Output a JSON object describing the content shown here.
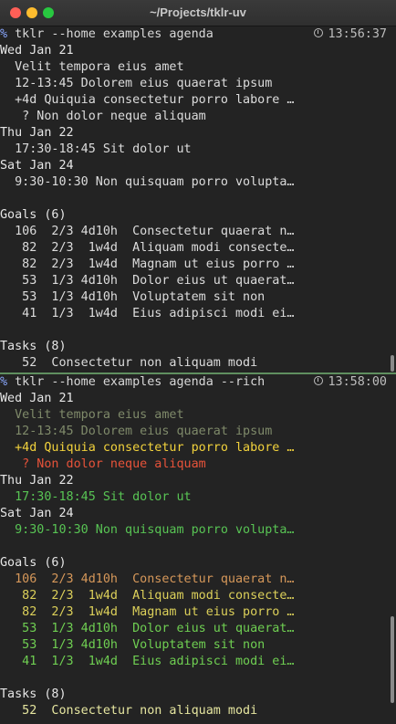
{
  "window": {
    "title": "~/Projects/tklr-uv"
  },
  "top": {
    "prompt_symbol": "%",
    "command": " tklr --home examples agenda",
    "clock": "13:56:37",
    "lines": [
      "Wed Jan 21",
      "  Velit tempora eius amet",
      "  12-13:45 Dolorem eius quaerat ipsum",
      "  +4d Quiquia consectetur porro labore …",
      "   ? Non dolor neque aliquam",
      "Thu Jan 22",
      "  17:30-18:45 Sit dolor ut",
      "Sat Jan 24",
      "  9:30-10:30 Non quisquam porro volupta…",
      "",
      "Goals (6)",
      "  106  2/3 4d10h  Consectetur quaerat n…",
      "   82  2/3  1w4d  Aliquam modi consecte…",
      "   82  2/3  1w4d  Magnam ut eius porro …",
      "   53  1/3 4d10h  Dolor eius ut quaerat…",
      "   53  1/3 4d10h  Voluptatem sit non",
      "   41  1/3  1w4d  Eius adipisci modi ei…",
      "",
      "Tasks (8)",
      "   52  Consectetur non aliquam modi"
    ]
  },
  "bottom": {
    "prompt_symbol": "%",
    "command": " tklr --home examples agenda --rich",
    "clock": "13:58:00",
    "lines": [
      "Wed Jan 21",
      "  Velit tempora eius amet",
      "  12-13:45 Dolorem eius quaerat ipsum",
      "  +4d Quiquia consectetur porro labore …",
      "   ? Non dolor neque aliquam",
      "Thu Jan 22",
      "  17:30-18:45 Sit dolor ut",
      "Sat Jan 24",
      "  9:30-10:30 Non quisquam porro volupta…",
      "",
      "Goals (6)",
      "  106  2/3 4d10h  Consectetur quaerat n…",
      "   82  2/3  1w4d  Aliquam modi consecte…",
      "   82  2/3  1w4d  Magnam ut eius porro …",
      "   53  1/3 4d10h  Dolor eius ut quaerat…",
      "   53  1/3 4d10h  Voluptatem sit non",
      "   41  1/3  1w4d  Eius adipisci modi ei…",
      "",
      "Tasks (8)",
      "   52  Consectetur non aliquam modi"
    ]
  },
  "colors": {
    "background": "#232323",
    "pane_divider": "#5f8f5f",
    "dim": "#7f8a6a",
    "yellow": "#f2d23c",
    "red": "#e8533a",
    "green": "#58c454",
    "goal_orange": "#d6985a",
    "goal_yellow": "#dcd05a",
    "goal_green": "#6fcf52"
  },
  "icons": [
    "clock-icon"
  ]
}
